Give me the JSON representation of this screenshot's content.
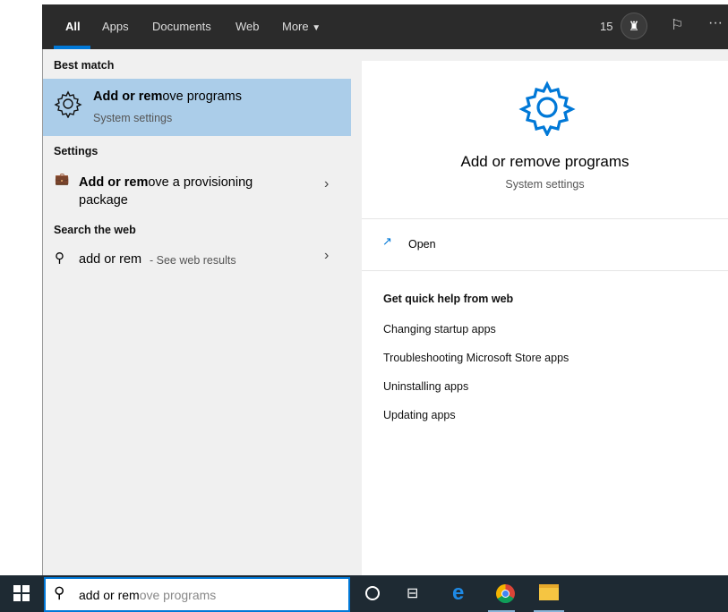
{
  "header": {
    "tabs": [
      "All",
      "Apps",
      "Documents",
      "Web",
      "More"
    ],
    "points": "15"
  },
  "left": {
    "best_match_label": "Best match",
    "best": {
      "title_bold": "Add or rem",
      "title_rest": "ove programs",
      "subtitle": "System settings"
    },
    "settings_label": "Settings",
    "setting_item": {
      "bold": "Add or rem",
      "rest": "ove a provisioning",
      "line2": "package"
    },
    "web_label": "Search the web",
    "web_item": {
      "query": "add or rem",
      "suffix": " - See web results"
    }
  },
  "right": {
    "title": "Add or remove programs",
    "subtitle": "System settings",
    "open": "Open",
    "help_label": "Get quick help from web",
    "links": [
      "Changing startup apps",
      "Troubleshooting Microsoft Store apps",
      "Uninstalling apps",
      "Updating apps"
    ]
  },
  "search": {
    "typed": "add or rem",
    "suggest": "ove programs"
  },
  "colors": {
    "accent": "#0078d7",
    "highlight": "#abcde9",
    "taskbar": "#1e2a33"
  }
}
